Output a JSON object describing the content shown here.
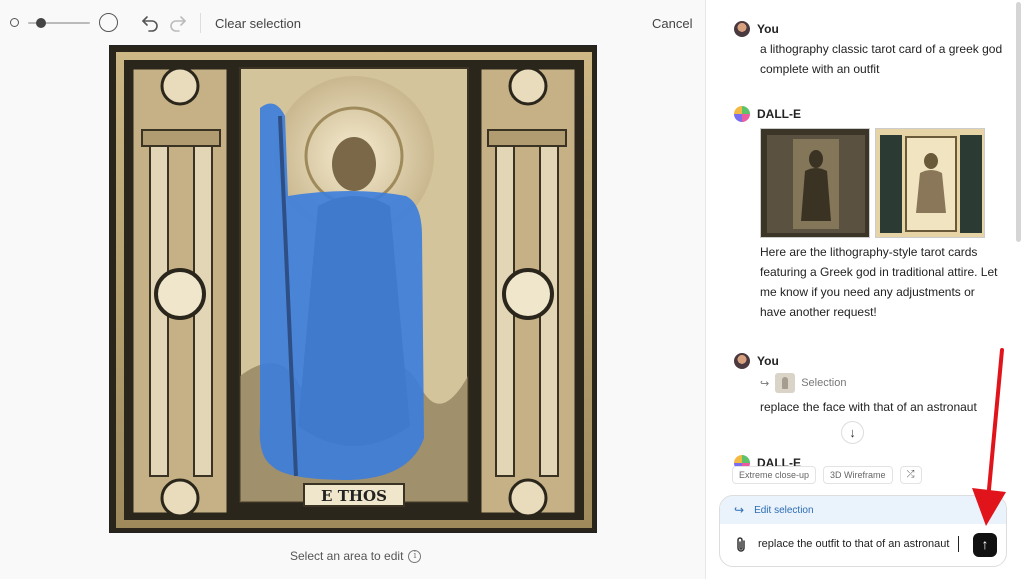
{
  "editor": {
    "clear_selection_label": "Clear selection",
    "cancel_label": "Cancel",
    "card_caption": "Ε THOS",
    "hint_text": "Select an area to edit"
  },
  "chat": {
    "messages": [
      {
        "author": "You",
        "text": "a lithography classic tarot card of a greek god complete with an outfit"
      },
      {
        "author": "DALL-E",
        "text": "Here are the lithography-style tarot cards featuring a Greek god in traditional attire. Let me know if you need any adjustments or have another request!"
      },
      {
        "author": "You",
        "selection_label": "Selection",
        "text": "replace the face with that of an astronaut"
      },
      {
        "author": "DALL-E"
      }
    ],
    "chips": [
      "Extreme close-up",
      "3D Wireframe"
    ],
    "edit_selection_label": "Edit selection",
    "input_value": "replace the outfit to that of an astronaut"
  },
  "colors": {
    "mask_blue": "#3b7ddd",
    "send_button": "#111111",
    "annotation_arrow": "#e0141a"
  }
}
